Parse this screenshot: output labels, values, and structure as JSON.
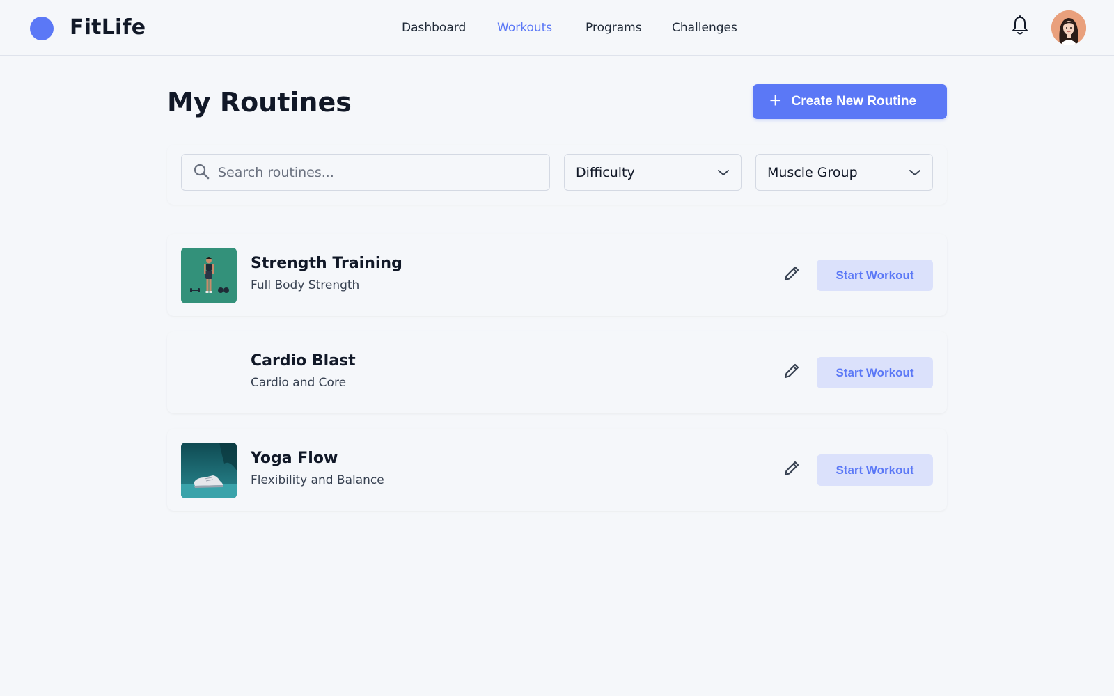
{
  "app": {
    "brand": "FitLife"
  },
  "nav": {
    "items": [
      {
        "label": "Dashboard",
        "active": false
      },
      {
        "label": "Workouts",
        "active": true
      },
      {
        "label": "Programs",
        "active": false
      },
      {
        "label": "Challenges",
        "active": false
      }
    ]
  },
  "header": {
    "bell_icon": "bell-icon",
    "avatar": "user-avatar"
  },
  "main": {
    "title": "My Routines",
    "create_button": {
      "label": "Create New Routine",
      "icon": "plus-icon"
    }
  },
  "filters": {
    "search": {
      "placeholder": "Search routines...",
      "value": "",
      "icon": "search-icon"
    },
    "difficulty": {
      "label": "Difficulty"
    },
    "muscle_group": {
      "label": "Muscle Group"
    }
  },
  "routines": [
    {
      "name": "Strength Training",
      "subtitle": "Full Body Strength",
      "action": "Start Workout",
      "thumbnail": "strength-image"
    },
    {
      "name": "Cardio Blast",
      "subtitle": "Cardio and Core",
      "action": "Start Workout",
      "thumbnail": "none"
    },
    {
      "name": "Yoga Flow",
      "subtitle": "Flexibility and Balance",
      "action": "Start Workout",
      "thumbnail": "sneaker-image"
    }
  ],
  "colors": {
    "accent": "#5b78f6",
    "accent_soft": "#dbe1fb",
    "background": "#f5f7fa",
    "text": "#111827"
  }
}
